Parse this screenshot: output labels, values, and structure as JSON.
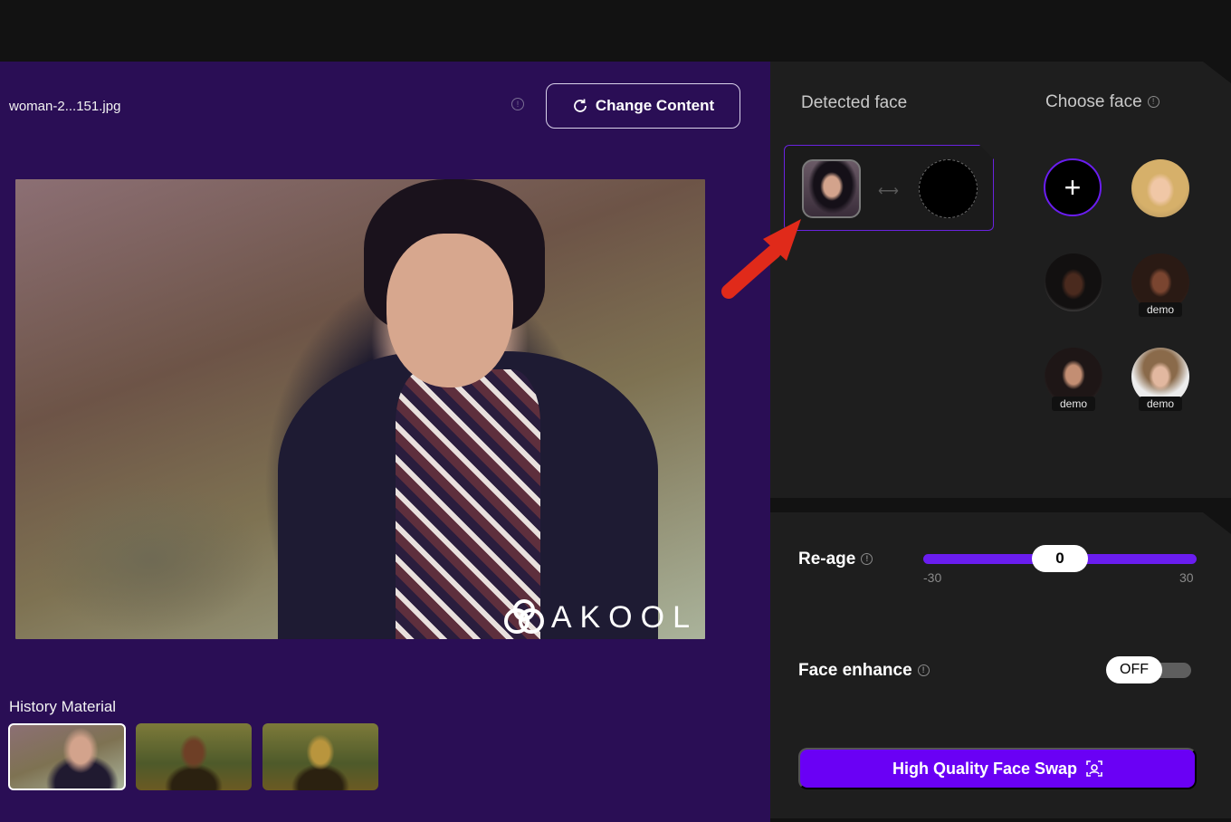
{
  "editor": {
    "file_name": "woman-2...151.jpg",
    "change_content_label": "Change Content",
    "watermark": "AKOOL",
    "history_title": "History Material"
  },
  "faces": {
    "detected_title": "Detected face",
    "choose_title": "Choose face",
    "add_symbol": "+",
    "demo_label": "demo"
  },
  "settings": {
    "reage_label": "Re-age",
    "reage_value": "0",
    "reage_min": "-30",
    "reage_max": "30",
    "enhance_label": "Face enhance",
    "enhance_state": "OFF",
    "swap_button_label": "High Quality Face Swap"
  },
  "colors": {
    "accent": "#6a00f5",
    "left_panel_bg": "#2a0e55",
    "right_panel_bg": "#1e1e1e",
    "callout_arrow": "#e02a1a"
  },
  "icons": {
    "change_content": "refresh-icon",
    "info": "info-icon",
    "swap_arrow": "double-arrow-icon",
    "hq_swap": "face-scan-icon",
    "callout": "red-arrow-icon"
  }
}
